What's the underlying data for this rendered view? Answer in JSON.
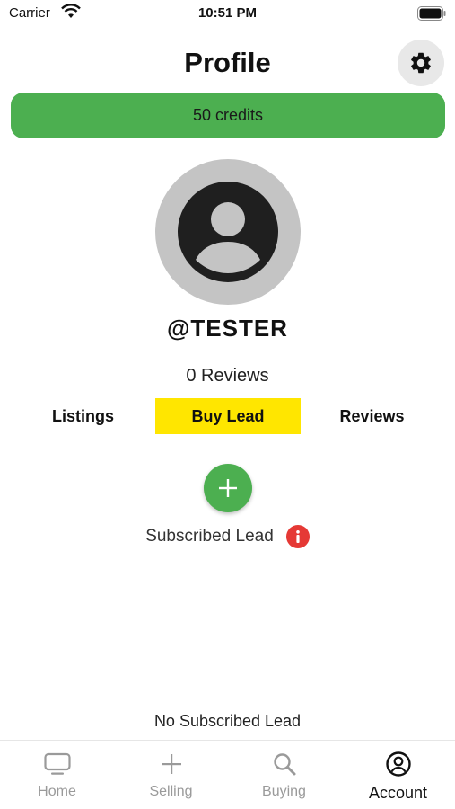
{
  "status_bar": {
    "carrier": "Carrier",
    "time": "10:51 PM"
  },
  "header": {
    "title": "Profile",
    "settings_icon": "gear-icon"
  },
  "credits": {
    "label": "50 credits",
    "color": "#4caf50"
  },
  "profile": {
    "username": "@TESTER",
    "reviews_count": "0 Reviews"
  },
  "tabs": [
    {
      "label": "Listings",
      "active": false
    },
    {
      "label": "Buy Lead",
      "active": true
    },
    {
      "label": "Reviews",
      "active": false
    }
  ],
  "accent_tab_color": "#ffe600",
  "subscribed": {
    "label": "Subscribed Lead",
    "add_icon": "plus-icon",
    "info_icon": "info-icon",
    "empty_message": "No Subscribed Lead"
  },
  "tabbar": [
    {
      "label": "Home",
      "icon": "tv-icon",
      "active": false
    },
    {
      "label": "Selling",
      "icon": "plus-icon",
      "active": false
    },
    {
      "label": "Buying",
      "icon": "search-icon",
      "active": false
    },
    {
      "label": "Account",
      "icon": "account-circle-icon",
      "active": true
    }
  ]
}
